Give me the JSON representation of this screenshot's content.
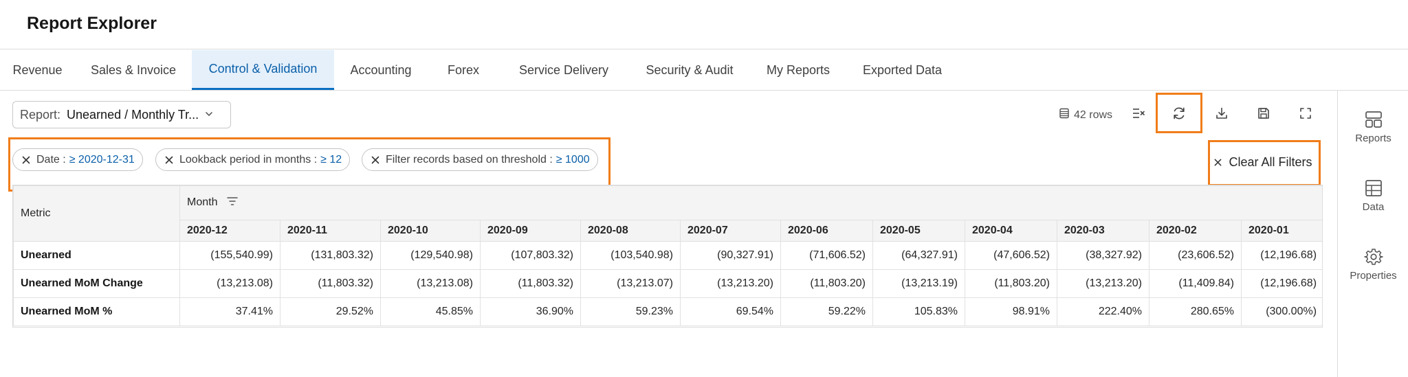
{
  "app": {
    "title": "Report Explorer"
  },
  "tabs": [
    {
      "label": "Revenue"
    },
    {
      "label": "Sales & Invoice"
    },
    {
      "label": "Control & Validation"
    },
    {
      "label": "Accounting"
    },
    {
      "label": "Forex"
    },
    {
      "label": "Service Delivery"
    },
    {
      "label": "Security & Audit"
    },
    {
      "label": "My Reports"
    },
    {
      "label": "Exported Data"
    }
  ],
  "active_tab": "Control & Validation",
  "toolbar": {
    "report_label": "Report:",
    "report_value": "Unearned / Monthly Tr...",
    "row_count": "42 rows",
    "icons": [
      "rows-icon",
      "clear-columns-icon",
      "refresh-icon",
      "download-icon",
      "save-icon",
      "fullscreen-icon"
    ]
  },
  "filters": [
    {
      "label": "Date :",
      "value": "≥ 2020-12-31"
    },
    {
      "label": "Lookback period in months :",
      "value": "≥ 12"
    },
    {
      "label": "Filter records based on threshold :",
      "value": "≥ 1000"
    }
  ],
  "clear_all_label": "Clear All Filters",
  "table": {
    "metric_header": "Metric",
    "group_header": "Month",
    "columns": [
      "2020-12",
      "2020-11",
      "2020-10",
      "2020-09",
      "2020-08",
      "2020-07",
      "2020-06",
      "2020-05",
      "2020-04",
      "2020-03",
      "2020-02",
      "2020-01"
    ],
    "rows": [
      {
        "metric": "Unearned",
        "values": [
          "(155,540.99)",
          "(131,803.32)",
          "(129,540.98)",
          "(107,803.32)",
          "(103,540.98)",
          "(90,327.91)",
          "(71,606.52)",
          "(64,327.91)",
          "(47,606.52)",
          "(38,327.92)",
          "(23,606.52)",
          "(12,196.68)"
        ]
      },
      {
        "metric": "Unearned MoM Change",
        "values": [
          "(13,213.08)",
          "(11,803.32)",
          "(13,213.08)",
          "(11,803.32)",
          "(13,213.07)",
          "(13,213.20)",
          "(11,803.20)",
          "(13,213.19)",
          "(11,803.20)",
          "(13,213.20)",
          "(11,409.84)",
          "(12,196.68)"
        ]
      },
      {
        "metric": "Unearned MoM %",
        "values": [
          "37.41%",
          "29.52%",
          "45.85%",
          "36.90%",
          "59.23%",
          "69.54%",
          "59.22%",
          "105.83%",
          "98.91%",
          "222.40%",
          "280.65%",
          "(300.00%)"
        ]
      }
    ]
  },
  "sidebar": {
    "items": [
      {
        "label": "Reports",
        "icon": "reports-icon"
      },
      {
        "label": "Data",
        "icon": "data-table-icon"
      },
      {
        "label": "Properties",
        "icon": "gear-icon"
      }
    ]
  },
  "colors": {
    "accent": "#0a6fc2",
    "highlight": "#f07d1a",
    "active_tab_bg": "#e5f0fb",
    "filter_value": "#0a5fa8"
  }
}
